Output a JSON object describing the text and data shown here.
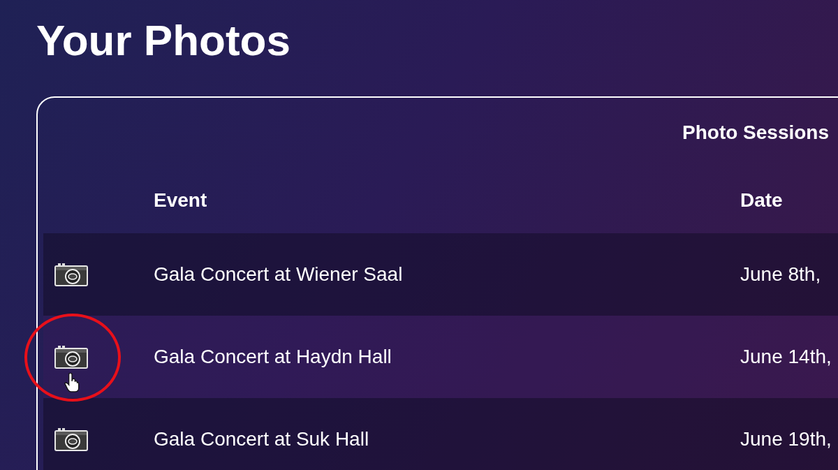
{
  "page": {
    "title": "Your Photos"
  },
  "table": {
    "caption": "Photo Sessions",
    "columns": [
      "Event",
      "Date"
    ],
    "rows": [
      {
        "event": "Gala Concert at Wiener Saal",
        "date": "June 8th,",
        "hovered": false,
        "circled": false,
        "cursor": false
      },
      {
        "event": "Gala Concert at Haydn Hall",
        "date": "June 14th,",
        "hovered": true,
        "circled": true,
        "cursor": true
      },
      {
        "event": "Gala Concert at Suk Hall",
        "date": "June 19th,",
        "hovered": false,
        "circled": false,
        "cursor": false
      }
    ]
  }
}
